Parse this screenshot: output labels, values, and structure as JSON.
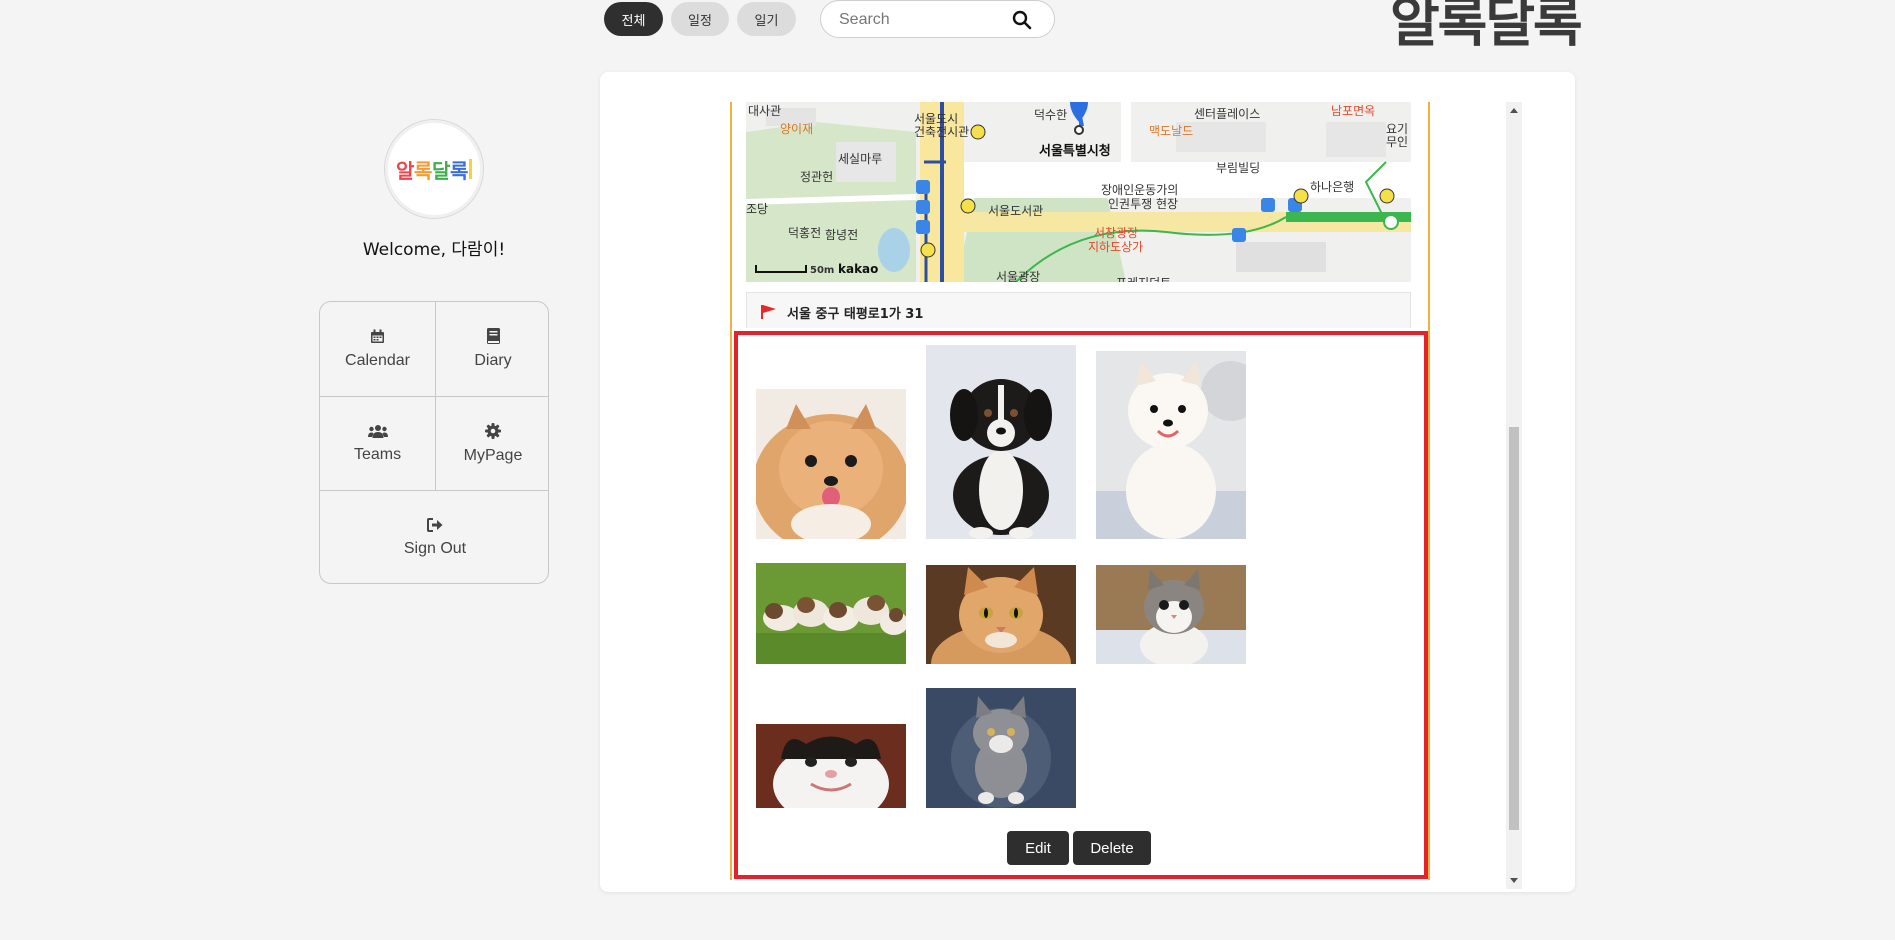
{
  "header": {
    "tabs": [
      {
        "label": "전체",
        "active": true
      },
      {
        "label": "일정",
        "active": false
      },
      {
        "label": "일기",
        "active": false
      }
    ],
    "search_placeholder": "Search",
    "brand": "알록달록"
  },
  "sidebar": {
    "logo_text": "알록달록",
    "welcome": "Welcome, 다람이!",
    "menu": [
      {
        "label": "Calendar",
        "icon": "calendar-icon"
      },
      {
        "label": "Diary",
        "icon": "book-icon"
      },
      {
        "label": "Teams",
        "icon": "users-icon"
      },
      {
        "label": "MyPage",
        "icon": "gear-icon"
      },
      {
        "label": "Sign Out",
        "icon": "sign-out-icon"
      }
    ]
  },
  "post": {
    "map": {
      "labels": [
        "대사관",
        "양이재",
        "서울도시",
        "건축전시관",
        "덕수한",
        "서울특별시청",
        "센터플레이스",
        "남포면옥",
        "요기",
        "무인",
        "맥도날드",
        "세실마루",
        "정관헌",
        "부림빌딩",
        "장애인운동가의",
        "인권투쟁 현장",
        "하나은행",
        "조당",
        "덕홍전",
        "함녕전",
        "서울도서관",
        "서창광장",
        "지하도상가",
        "서울광장",
        "프레지던트"
      ],
      "scale": "50m",
      "provider": "kakao"
    },
    "address": "서울 중구 태평로1가 31",
    "photos": [
      {
        "subject": "pomeranian-orange"
      },
      {
        "subject": "puppy-black-white"
      },
      {
        "subject": "pomeranian-white"
      },
      {
        "subject": "puppies-on-grass"
      },
      {
        "subject": "cat-orange"
      },
      {
        "subject": "cat-tabby-white"
      },
      {
        "subject": "cat-smiling"
      },
      {
        "subject": "kitten-grey-jumping"
      }
    ],
    "edit_label": "Edit",
    "delete_label": "Delete"
  },
  "colors": {
    "accent_frame": "#f0b23a",
    "highlight": "#e3232b",
    "button_dark": "#2e2e2e",
    "pill_active": "#2f2f2f"
  }
}
